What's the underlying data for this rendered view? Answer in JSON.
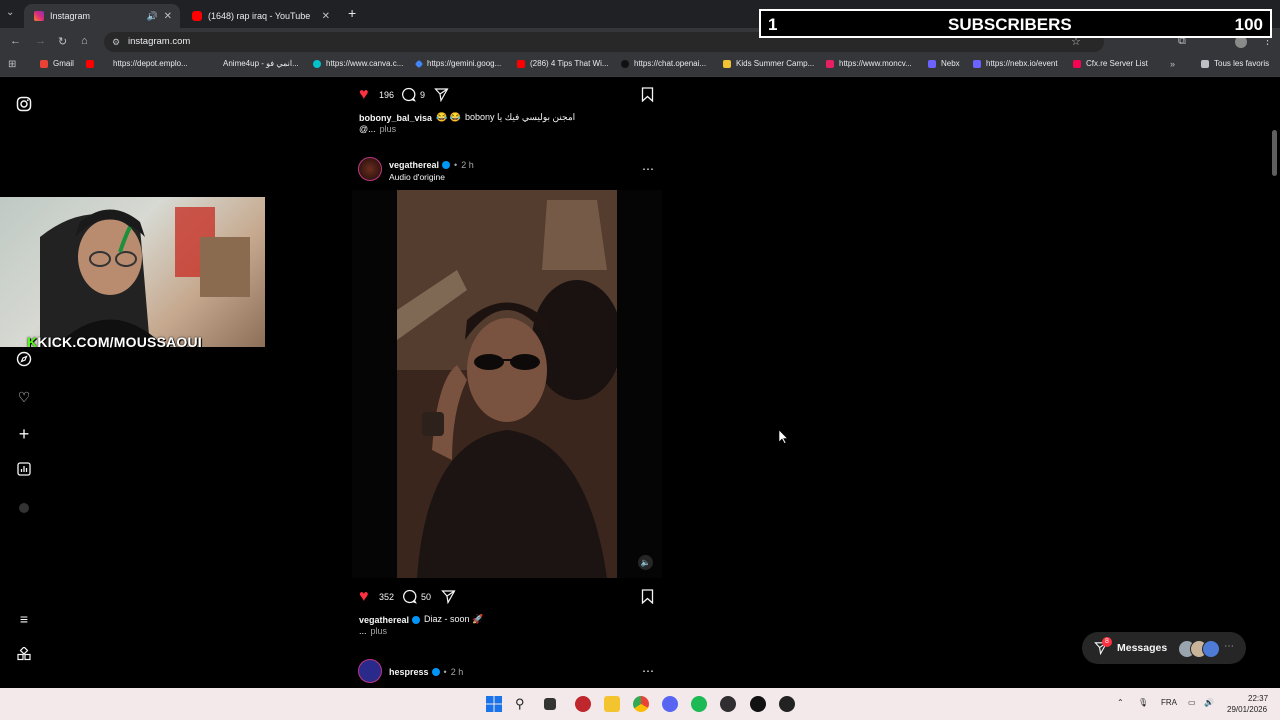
{
  "browser": {
    "tabs": [
      {
        "label": "Instagram",
        "active": true
      },
      {
        "label": "(1648) rap iraq - YouTube",
        "active": false
      }
    ],
    "url": "instagram.com",
    "bookmarks": [
      "Gmail",
      "https://depot.emplo...",
      "Anime4up - انمي فو...",
      "https://www.canva.c...",
      "https://gemini.goog...",
      "(286) 4 Tips That Wi...",
      "https://chat.openai...",
      "Kids Summer Camp...",
      "https://www.moncv...",
      "Nebx",
      "https://nebx.io/event",
      "Cfx.re Server List"
    ],
    "all_bookmarks": "Tous les favoris"
  },
  "overlay": {
    "subs_left": "1",
    "subs_label": "SUBSCRIBERS",
    "subs_right": "100",
    "kick_k": "K",
    "kick_text": "KICK.COM/MOUSSAOUI"
  },
  "feed": {
    "post1": {
      "likes": "196",
      "comments": "9",
      "username": "bobony_bal_visa",
      "emojis": "😂 😂",
      "caption": "bobony امجنن بوليسي فيك يا",
      "caption_more": "@...",
      "more": "plus"
    },
    "post2": {
      "username": "vegathereal",
      "time": "2 h",
      "audio": "Audio d'origine",
      "likes": "352",
      "comments": "50",
      "caption": "Diaz - soon 🚀",
      "caption_more": "...",
      "more": "plus"
    },
    "post3": {
      "username": "hespress",
      "time": "2 h"
    }
  },
  "messages": {
    "label": "Messages",
    "badge": "8"
  },
  "taskbar": {
    "lang": "FRA",
    "time": "22:37",
    "date": "29/01/2026"
  },
  "colors": {
    "like": "#ff3040",
    "verified": "#0095f6",
    "kick_green": "#53fc18"
  }
}
